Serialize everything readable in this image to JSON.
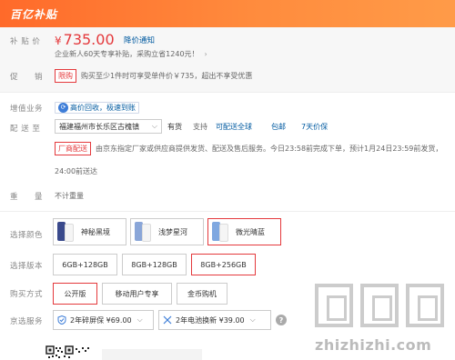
{
  "header": {
    "brand": "百亿补贴"
  },
  "subsidy_price": {
    "label": "补 贴 价",
    "currency": "¥",
    "amount": "735.00",
    "notice_link": "降价通知",
    "subsidy_note": "企业新人60天专享补贴，采购立省1240元！",
    "subsidy_arrow": "›"
  },
  "promotion": {
    "label": "促　　销",
    "tag": "限购",
    "text": "购买至少1件时可享受单件价￥735，超出不享受优惠"
  },
  "value_added": {
    "label": "增值业务",
    "icon_glyph": "⟳",
    "text": "高价回收，极速到账"
  },
  "delivery": {
    "label": "配 送 至",
    "address": "福建福州市长乐区古槐镇",
    "chevron": "⌵",
    "stock": "有货",
    "support": "支持",
    "support_link": "可配送全球",
    "free_ship": "包邮",
    "return_policy": "7天价保",
    "tag": "厂商配送",
    "notice_line1": "由京东指定厂家或供应商提供发货、配送及售后服务。今日23:58前完成下单，预计1月24日23:59前发货，",
    "notice_line2": "24:00前送达"
  },
  "weight": {
    "label": "重　　量",
    "value": "不计重量"
  },
  "color": {
    "label": "选择颜色",
    "options": [
      {
        "label": "神秘黑境",
        "selected": false,
        "swatch": "#3a4a8c"
      },
      {
        "label": "浅梦星河",
        "selected": false,
        "swatch": "#8aa6d8"
      },
      {
        "label": "微光晴蓝",
        "selected": true,
        "swatch": "#7fa8e0"
      }
    ]
  },
  "version": {
    "label": "选择版本",
    "options": [
      {
        "label": "6GB+128GB",
        "selected": false
      },
      {
        "label": "8GB+128GB",
        "selected": false
      },
      {
        "label": "8GB+256GB",
        "selected": true
      }
    ]
  },
  "purchase_mode": {
    "label": "购买方式",
    "options": [
      {
        "label": "公开版",
        "selected": true
      },
      {
        "label": "移动用户专享",
        "selected": false
      },
      {
        "label": "金币购机",
        "selected": false
      }
    ]
  },
  "jd_service": {
    "label": "京选服务",
    "addons": [
      {
        "icon": "shield-icon",
        "text": "2年碎屏保 ¥69.00"
      },
      {
        "icon": "wrench-icon",
        "text": "2年电池换新 ¥39.00"
      }
    ],
    "chevron": "⌵",
    "help_glyph": "?"
  },
  "watermark": {
    "text": "zhizhizhi.com"
  },
  "colors": {
    "accent": "#e4393c",
    "link": "#005aa0",
    "header_start": "#ff6a2a",
    "header_end": "#ff9b48"
  }
}
